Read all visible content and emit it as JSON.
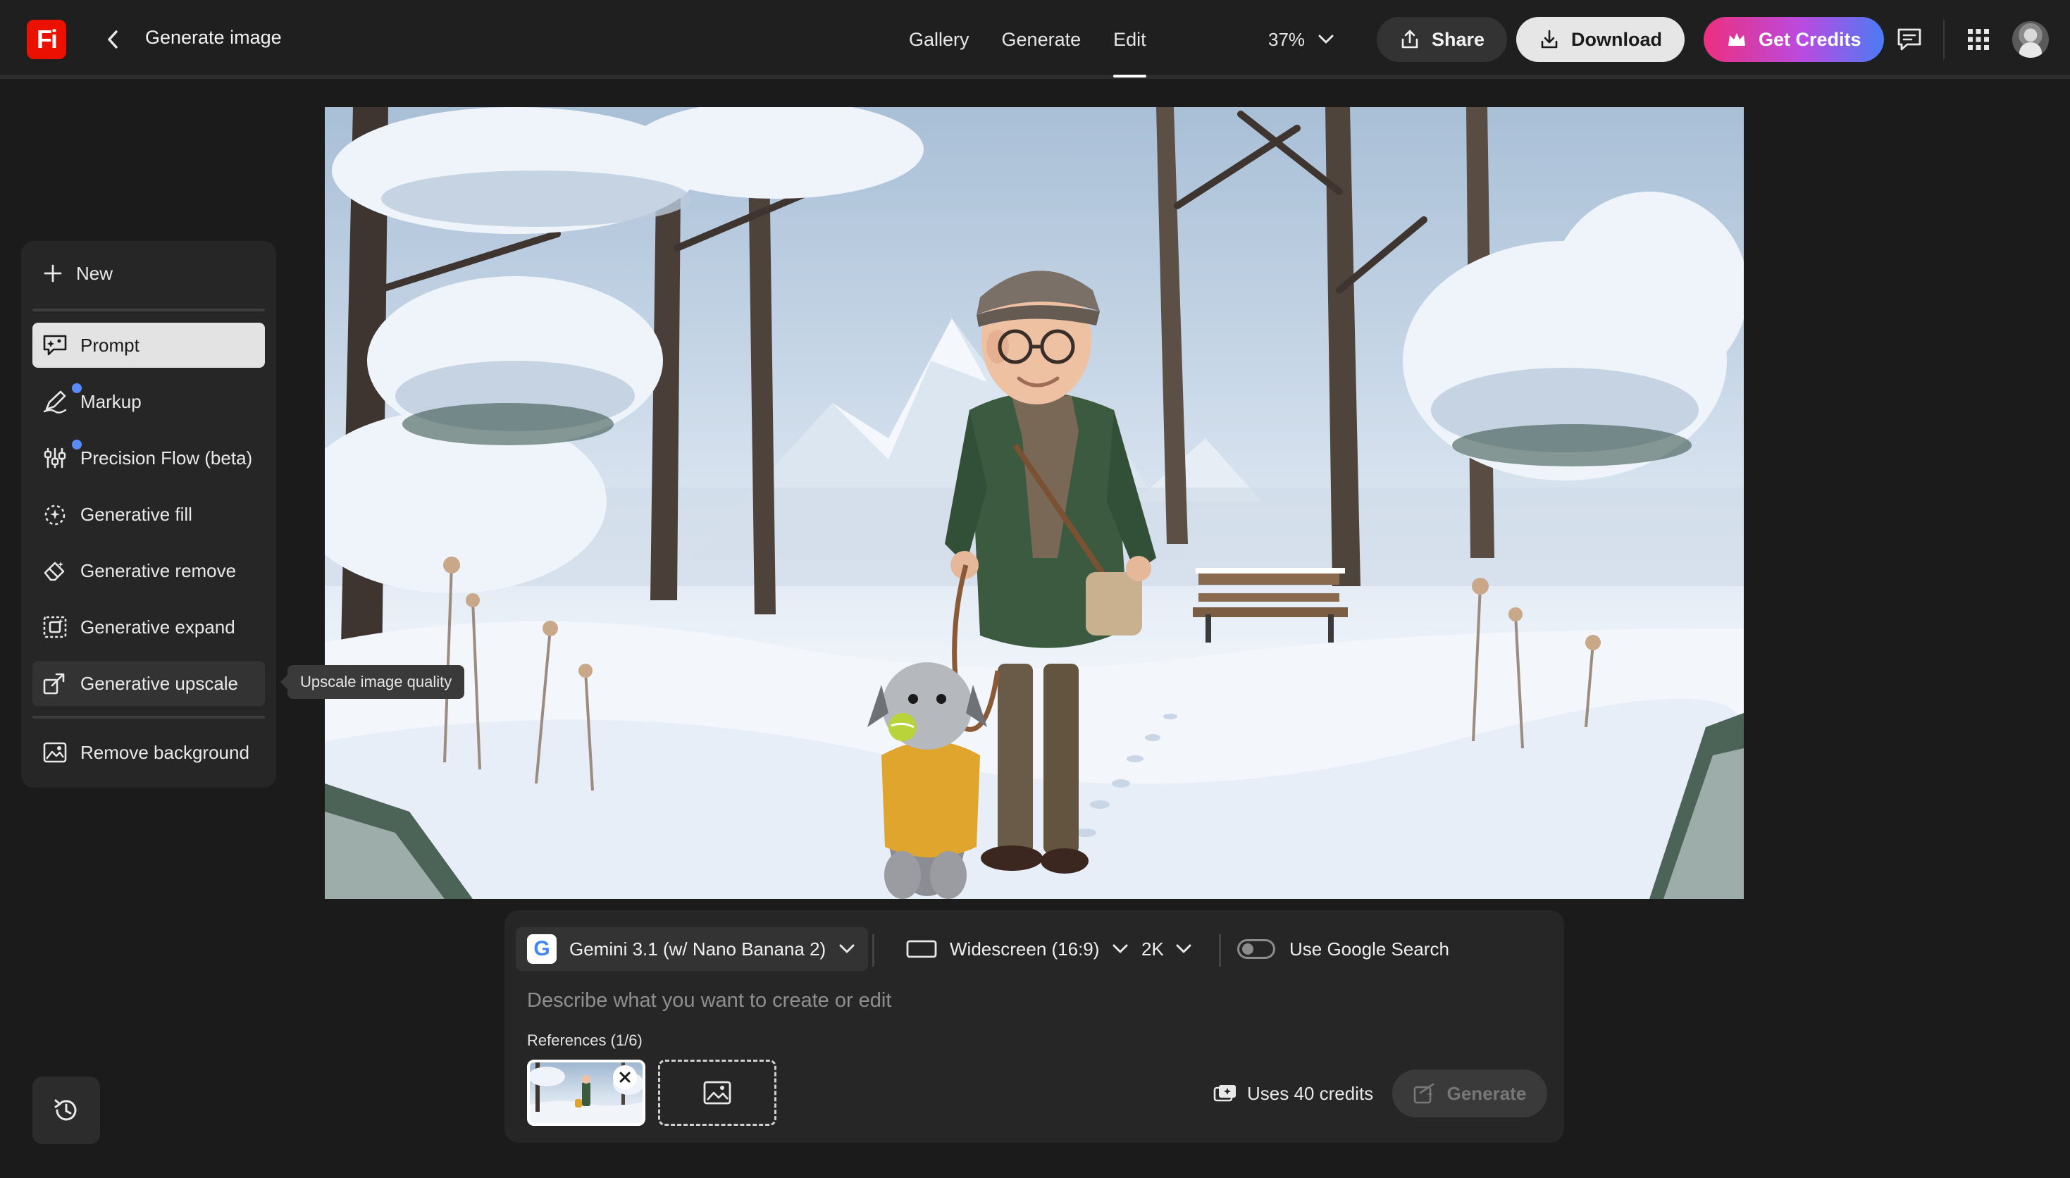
{
  "header": {
    "logo_text": "Fi",
    "title": "Generate image",
    "tabs": [
      {
        "label": "Gallery",
        "active": false
      },
      {
        "label": "Generate",
        "active": false
      },
      {
        "label": "Edit",
        "active": true
      }
    ],
    "zoom": "37%",
    "share_label": "Share",
    "download_label": "Download",
    "credits_label": "Get Credits",
    "accent_colors": {
      "logo": "#eb1000",
      "gradient_start": "#ec2f7f",
      "gradient_end": "#4b7bf3"
    }
  },
  "canvas": {
    "image_subject": "elderly-man-with-dog-in-snowy-forest"
  },
  "tools": {
    "new_label": "New",
    "items": [
      {
        "label": "Prompt",
        "icon": "prompt-icon",
        "active": true
      },
      {
        "label": "Markup",
        "icon": "markup-icon",
        "active": false
      },
      {
        "label": "Precision Flow (beta)",
        "icon": "sliders-icon",
        "active": false
      },
      {
        "label": "Generative fill",
        "icon": "generative-fill-icon",
        "active": false
      },
      {
        "label": "Generative remove",
        "icon": "eraser-icon",
        "active": false
      },
      {
        "label": "Generative expand",
        "icon": "expand-icon",
        "active": false
      },
      {
        "label": "Generative upscale",
        "icon": "upscale-icon",
        "active": false
      },
      {
        "label": "Remove background",
        "icon": "remove-background-icon",
        "active": false
      }
    ],
    "tooltip": "Upscale image quality"
  },
  "prompt_panel": {
    "model": "Gemini 3.1 (w/ Nano Banana 2)",
    "model_logo": "G",
    "aspect_ratio": "Widescreen (16:9)",
    "resolution": "2K",
    "google_search_label": "Use Google Search",
    "google_search_enabled": false,
    "placeholder": "Describe what you want to create or edit",
    "references_label": "References (1/6)",
    "credits_text": "Uses 40 credits",
    "generate_label": "Generate"
  }
}
